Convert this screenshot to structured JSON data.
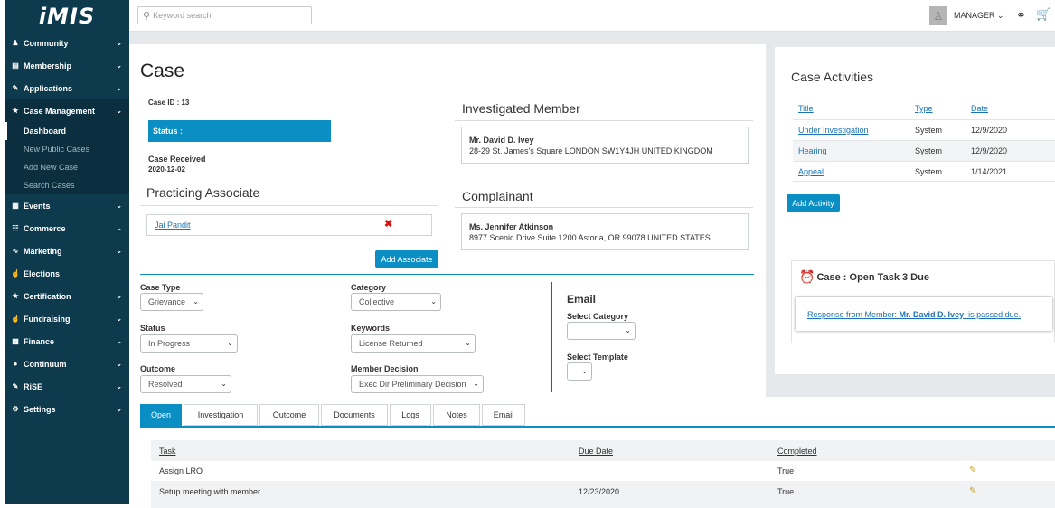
{
  "logo": "iMIS",
  "sidebar": {
    "items": [
      {
        "label": "Community",
        "icon": "people-icon"
      },
      {
        "label": "Membership",
        "icon": "card-icon"
      },
      {
        "label": "Applications",
        "icon": "edit-icon"
      },
      {
        "label": "Case Management",
        "icon": "badge-icon"
      },
      {
        "label": "Events",
        "icon": "calendar-icon"
      },
      {
        "label": "Commerce",
        "icon": "cart-icon"
      },
      {
        "label": "Marketing",
        "icon": "chart-icon"
      },
      {
        "label": "Elections",
        "icon": "ballot-icon"
      },
      {
        "label": "Certification",
        "icon": "ribbon-icon"
      },
      {
        "label": "Fundraising",
        "icon": "hand-icon"
      },
      {
        "label": "Finance",
        "icon": "money-icon"
      },
      {
        "label": "Continuum",
        "icon": "globe-icon"
      },
      {
        "label": "RiSE",
        "icon": "edit-icon"
      },
      {
        "label": "Settings",
        "icon": "gear-icon"
      }
    ],
    "case_sub": [
      "Dashboard",
      "New Public Cases",
      "Add New Case",
      "Search Cases"
    ]
  },
  "header": {
    "search_placeholder": "Keyword search",
    "user": "MANAGER"
  },
  "case": {
    "title": "Case",
    "id_label": "Case ID : 13",
    "status_label": "Status :",
    "received_label": "Case Received",
    "received_date": "2020-12-02",
    "practicing_heading": "Practicing Associate",
    "associate": "Jai Pandit",
    "add_associate": "Add Associate",
    "investigated_heading": "Investigated Member",
    "investigated_name": "Mr. David D. Ivey",
    "investigated_address": "28-29 St. James's Square LONDON SW1Y4JH UNITED KINGDOM",
    "complainant_heading": "Complainant",
    "complainant_name": "Ms. Jennifer Atkinson",
    "complainant_address": "8977 Scenic Drive Suite 1200 Astoria, OR 99078 UNITED STATES"
  },
  "form": {
    "case_type_label": "Case Type",
    "case_type": "Grievance",
    "category_label": "Category",
    "category": "Collective",
    "status_label": "Status",
    "status": "In Progress",
    "keywords_label": "Keywords",
    "keywords": "License Returned",
    "outcome_label": "Outcome",
    "outcome": "Resolved",
    "decision_label": "Member Decision",
    "decision": "Exec Dir Preliminary Decision",
    "email_heading": "Email",
    "select_category_label": "Select Category",
    "select_template_label": "Select Template"
  },
  "tabs": [
    "Open",
    "Investigation",
    "Outcome",
    "Documents",
    "Logs",
    "Notes",
    "Email"
  ],
  "tasks": {
    "headers": {
      "task": "Task",
      "due": "Due Date",
      "completed": "Completed"
    },
    "rows": [
      {
        "task": "Assign LRO",
        "due": "",
        "completed": "True"
      },
      {
        "task": "Setup meeting with member",
        "due": "12/23/2020",
        "completed": "True"
      }
    ]
  },
  "activities": {
    "heading": "Case Activities",
    "headers": {
      "title": "Title",
      "type": "Type",
      "date": "Date"
    },
    "rows": [
      {
        "title": "Under Investigation",
        "type": "System",
        "date": "12/9/2020"
      },
      {
        "title": "Hearing",
        "type": "System",
        "date": "12/9/2020"
      },
      {
        "title": "Appeal",
        "type": "System",
        "date": "1/14/2021"
      }
    ],
    "add_button": "Add Activity"
  },
  "open_task": {
    "heading": "Case : Open Task 3 Due",
    "msg_prefix": "Response from Member: ",
    "msg_name": "Mr. David D. Ivey",
    "msg_suffix": "  is passed due."
  }
}
